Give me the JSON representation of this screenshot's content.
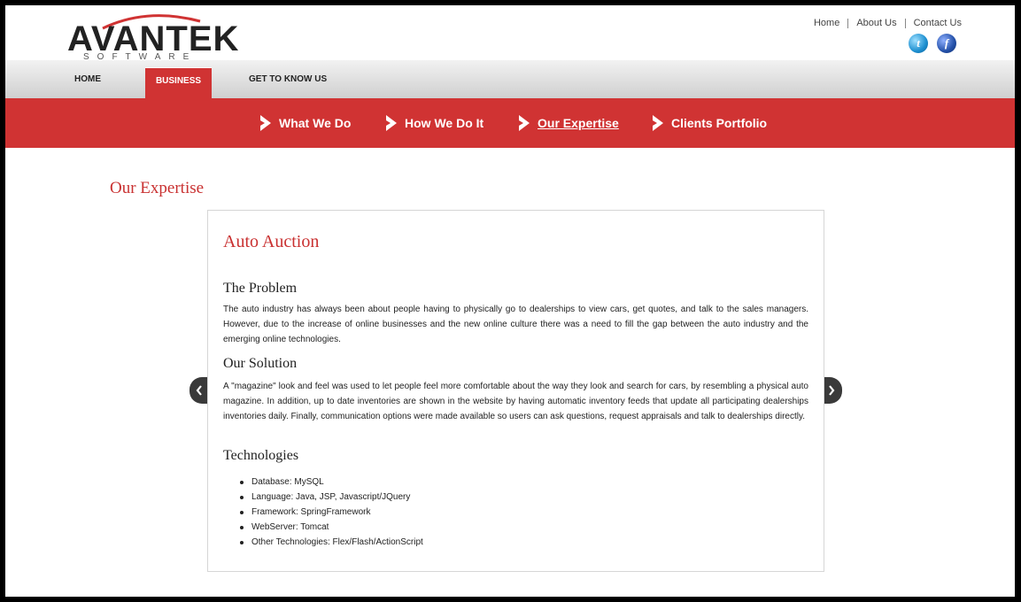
{
  "brand": {
    "name": "AVANTEK",
    "tagline": "SOFTWARE"
  },
  "top_links": [
    {
      "label": "Home"
    },
    {
      "label": "About Us"
    },
    {
      "label": "Contact Us"
    }
  ],
  "social": [
    {
      "name": "twitter-icon",
      "glyph": "t"
    },
    {
      "name": "facebook-icon",
      "glyph": "f"
    }
  ],
  "main_nav": [
    {
      "label": "HOME"
    },
    {
      "label": "BUSINESS",
      "active": true
    },
    {
      "label": "GET TO KNOW US"
    }
  ],
  "sub_nav": [
    {
      "label": "What We Do"
    },
    {
      "label": "How We Do It"
    },
    {
      "label": "Our Expertise",
      "current": true
    },
    {
      "label": "Clients Portfolio"
    }
  ],
  "content": {
    "section_title": "Our Expertise",
    "card_title": "Auto Auction",
    "problem_heading": "The Problem",
    "problem_text": "The auto industry has always been about people having to physically go to dealerships to view cars, get quotes, and talk to the sales managers. However, due to the increase of online businesses and the new online culture there was a need to fill the gap between the auto industry and the emerging online technologies.",
    "solution_heading": "Our Solution",
    "solution_text": "A \"magazine\" look and feel was used to let people feel more comfortable about the way they look and search for cars, by resembling a physical auto magazine. In addition, up to date inventories are shown in the website by having automatic inventory feeds that update all participating dealerships inventories daily. Finally, communication options were made available so users can ask questions, request appraisals and talk to dealerships directly.",
    "tech_heading": "Technologies",
    "technologies": [
      "Database: MySQL",
      "Language: Java, JSP, Javascript/JQuery",
      "Framework: SpringFramework",
      "WebServer: Tomcat",
      "Other Technologies: Flex/Flash/ActionScript"
    ]
  },
  "colors": {
    "accent": "#d03333",
    "title": "#c93131",
    "nav_bg": "#dcdcdc"
  }
}
